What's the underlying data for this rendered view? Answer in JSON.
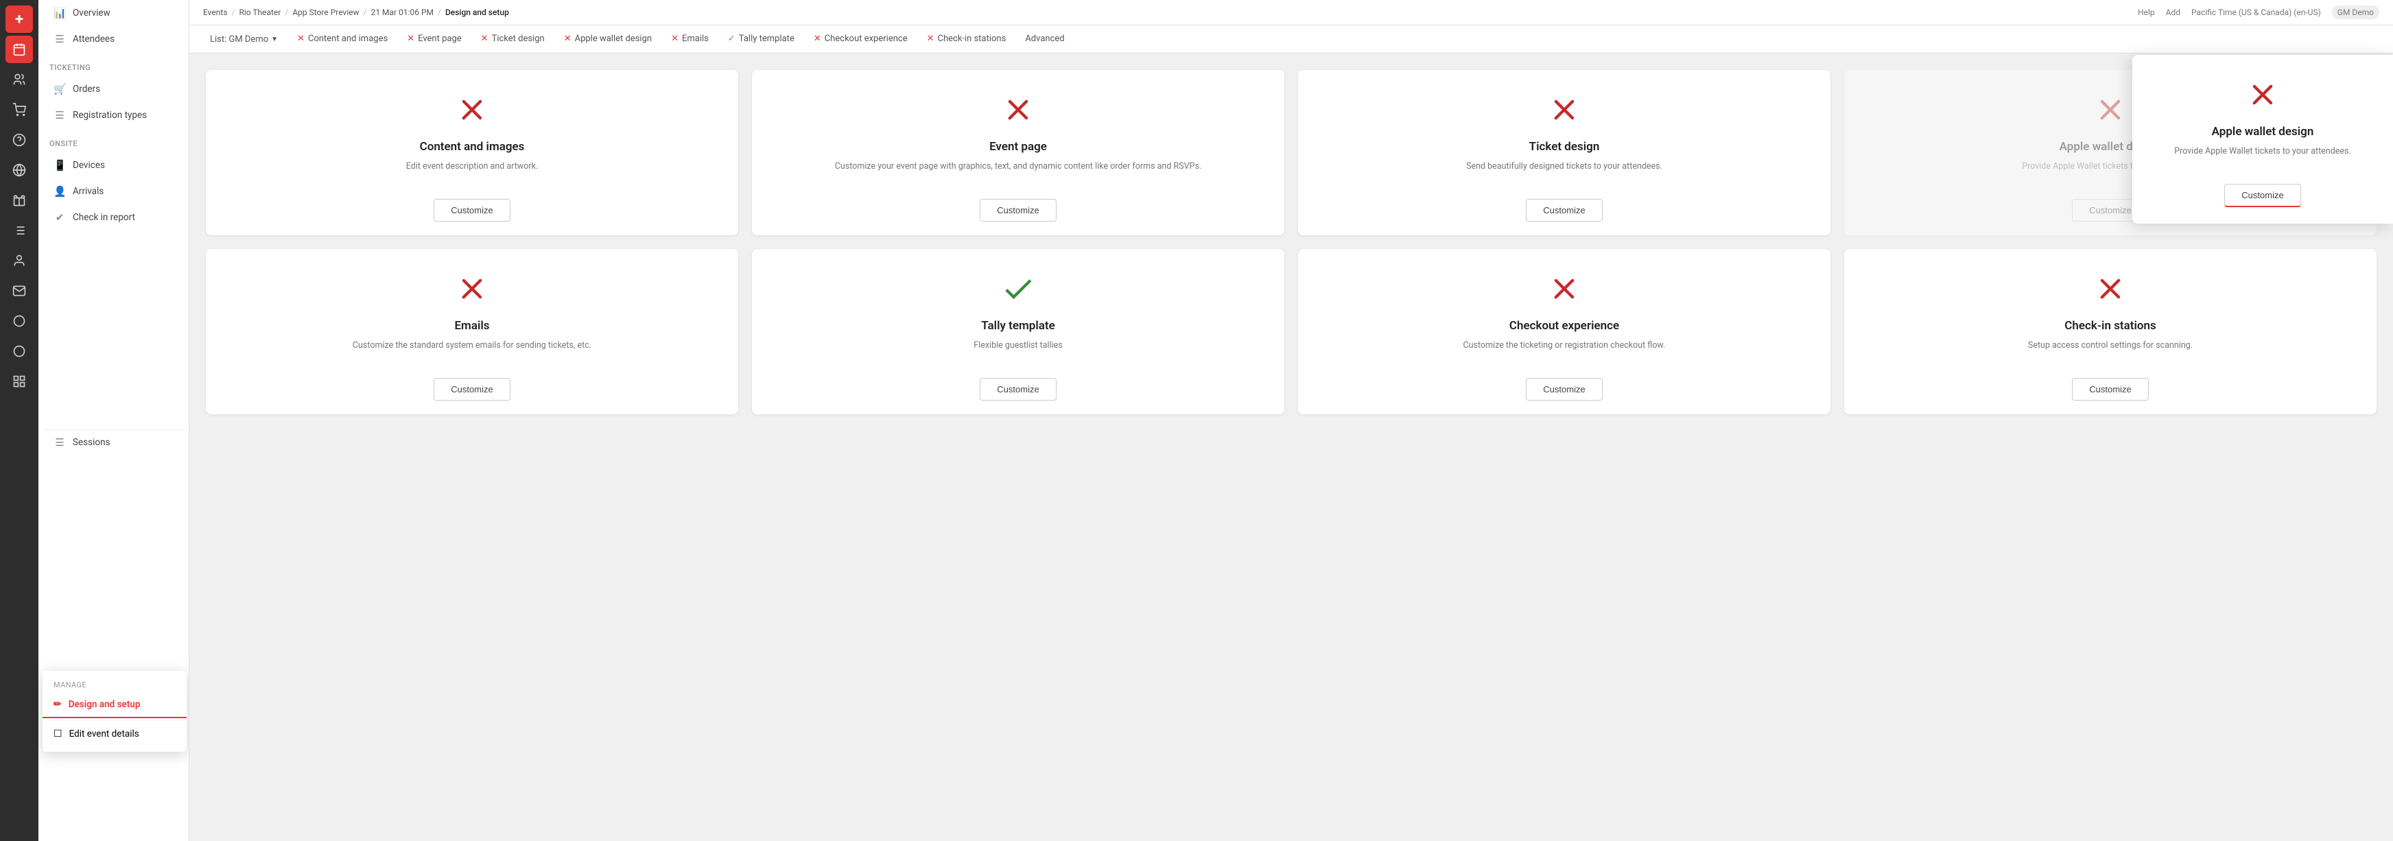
{
  "sidebar_icons": [
    {
      "name": "plus-icon",
      "symbol": "+",
      "active": true
    },
    {
      "name": "calendar-icon",
      "symbol": "📅",
      "active": false
    },
    {
      "name": "people-icon",
      "symbol": "👥",
      "active": false
    },
    {
      "name": "cart-icon",
      "symbol": "🛒",
      "active": false
    },
    {
      "name": "question-icon",
      "symbol": "?",
      "active": false
    },
    {
      "name": "globe-icon",
      "symbol": "🌐",
      "active": false
    },
    {
      "name": "gift-icon",
      "symbol": "🎁",
      "active": false
    },
    {
      "name": "list-icon",
      "symbol": "☰",
      "active": false
    },
    {
      "name": "person-icon",
      "symbol": "👤",
      "active": false
    },
    {
      "name": "mail-icon",
      "symbol": "✉",
      "active": false
    },
    {
      "name": "search-icon",
      "symbol": "○",
      "active": false
    },
    {
      "name": "search2-icon",
      "symbol": "○",
      "active": false
    },
    {
      "name": "grid-icon",
      "symbol": "▦",
      "active": false
    }
  ],
  "nav": {
    "items_top": [
      {
        "label": "Overview",
        "icon": "📊"
      },
      {
        "label": "Attendees",
        "icon": "☰"
      }
    ],
    "section_ticketing": "Ticketing",
    "items_ticketing": [
      {
        "label": "Orders",
        "icon": "🛒"
      },
      {
        "label": "Registration types",
        "icon": "☰"
      }
    ],
    "section_onsite": "Onsite",
    "items_onsite": [
      {
        "label": "Devices",
        "icon": "📱"
      },
      {
        "label": "Arrivals",
        "icon": "👤"
      },
      {
        "label": "Check in report",
        "icon": "✔"
      }
    ]
  },
  "dropdown": {
    "label": "Manage",
    "items": [
      {
        "label": "Design and setup",
        "icon": "✏",
        "active": true
      },
      {
        "label": "Edit event details",
        "icon": "☐",
        "active": false
      }
    ],
    "below_item": {
      "label": "Sessions",
      "icon": "☰"
    }
  },
  "breadcrumb": {
    "parts": [
      "Events",
      "Rio Theater",
      "App Store Preview",
      "21 Mar 01:06 PM",
      "Design and setup"
    ],
    "right": [
      "Help",
      "Add",
      "Pacific Time (US & Canada) (en-US)",
      "GM Demo"
    ]
  },
  "tabs": [
    {
      "label": "List: GM Demo",
      "type": "list",
      "status": null
    },
    {
      "label": "Content and images",
      "type": "tab",
      "status": "x"
    },
    {
      "label": "Event page",
      "type": "tab",
      "status": "x"
    },
    {
      "label": "Ticket design",
      "type": "tab",
      "status": "x"
    },
    {
      "label": "Apple wallet design",
      "type": "tab",
      "status": "x"
    },
    {
      "label": "Emails",
      "type": "tab",
      "status": "x"
    },
    {
      "label": "Tally template",
      "type": "tab",
      "status": "check"
    },
    {
      "label": "Checkout experience",
      "type": "tab",
      "status": "x"
    },
    {
      "label": "Check-in stations",
      "type": "tab",
      "status": "x"
    },
    {
      "label": "Advanced",
      "type": "tab",
      "status": null
    }
  ],
  "cards": [
    {
      "id": "content-images",
      "title": "Content and images",
      "desc": "Edit event description and artwork.",
      "status": "x",
      "btn": "Customize"
    },
    {
      "id": "event-page",
      "title": "Event page",
      "desc": "Customize your event page with graphics, text, and dynamic content like order forms and RSVPs.",
      "status": "x",
      "btn": "Customize"
    },
    {
      "id": "ticket-design",
      "title": "Ticket design",
      "desc": "Send beautifully designed tickets to your attendees.",
      "status": "x",
      "btn": "Customize"
    },
    {
      "id": "apple-wallet",
      "title": "Apple wallet design",
      "desc": "Provide Apple Wallet tickets to your attendees.",
      "status": "x",
      "btn": "Customize",
      "highlighted": true
    },
    {
      "id": "emails",
      "title": "Emails",
      "desc": "Customize the standard system emails for sending tickets, etc.",
      "status": "x",
      "btn": "Customize"
    },
    {
      "id": "tally-template",
      "title": "Tally template",
      "desc": "Flexible guestlist tallies",
      "status": "check",
      "btn": "Customize"
    },
    {
      "id": "checkout-experience",
      "title": "Checkout experience",
      "desc": "Customize the ticketing or registration checkout flow.",
      "status": "x",
      "btn": "Customize"
    },
    {
      "id": "checkin-stations",
      "title": "Check-in stations",
      "desc": "Setup access control settings for scanning.",
      "status": "x",
      "btn": "Customize"
    }
  ],
  "overlay": {
    "title": "Apple wallet design",
    "desc": "Provide Apple Wallet tickets to your attendees.",
    "btn": "Customize",
    "status": "x"
  },
  "colors": {
    "red": "#c62828",
    "green": "#388e3c",
    "accent": "#e53935"
  }
}
